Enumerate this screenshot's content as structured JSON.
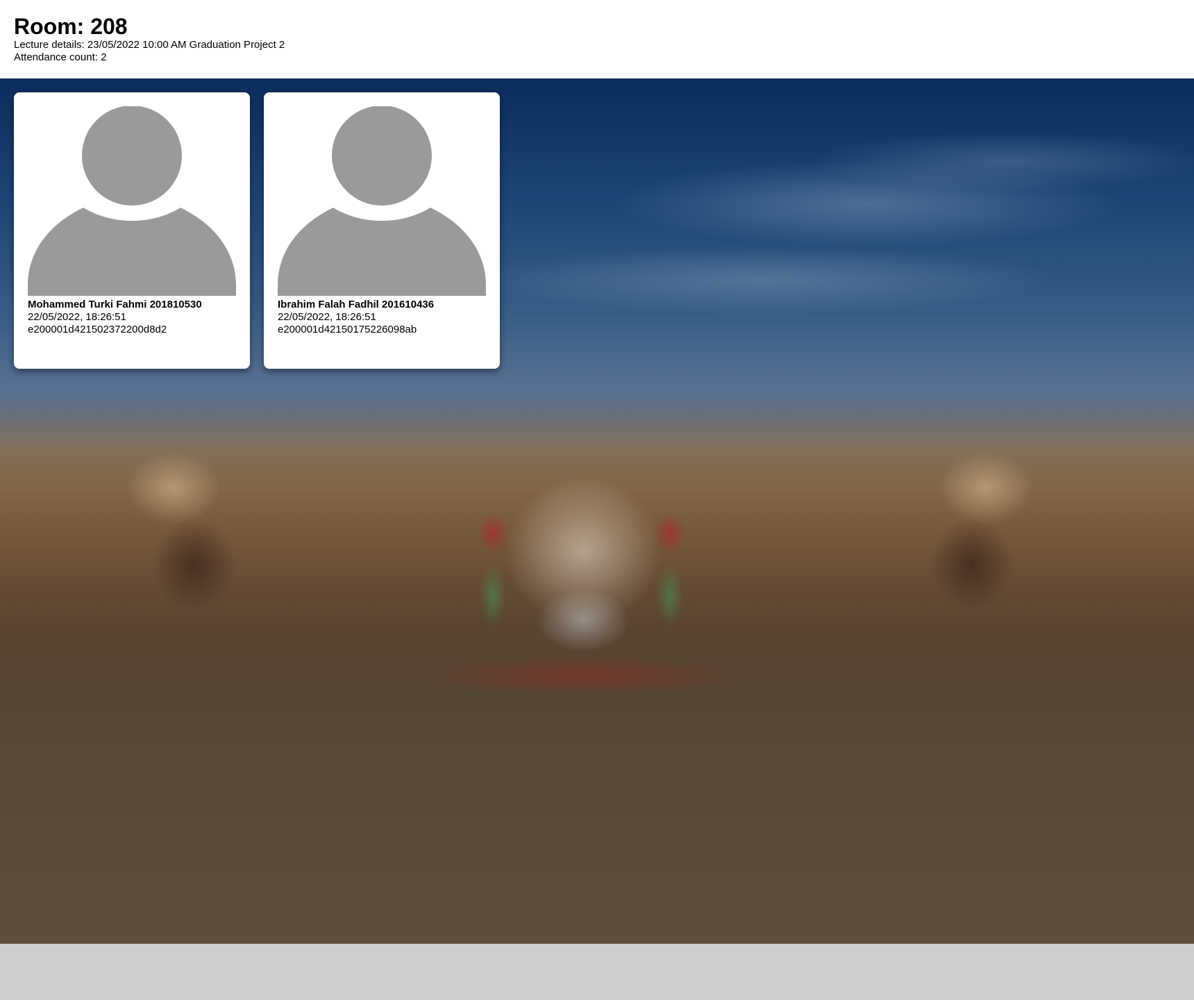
{
  "header": {
    "room_title": "Room: 208",
    "lecture_details": "Lecture details: 23/05/2022 10:00 AM Graduation Project 2",
    "attendance_count": "Attendance count: 2"
  },
  "attendees": [
    {
      "name_id": "Mohammed Turki Fahmi 201810530",
      "timestamp": "22/05/2022, 18:26:51",
      "tag_id": "e200001d421502372200d8d2",
      "avatar_icon": "user-placeholder-icon"
    },
    {
      "name_id": "Ibrahim Falah Fadhil 201610436",
      "timestamp": "22/05/2022, 18:26:51",
      "tag_id": "e200001d42150175226098ab",
      "avatar_icon": "user-placeholder-icon"
    }
  ],
  "colors": {
    "avatar_gray": "#9a9a9a",
    "card_bg": "#ffffff",
    "page_bottom": "#cdcdcd"
  }
}
